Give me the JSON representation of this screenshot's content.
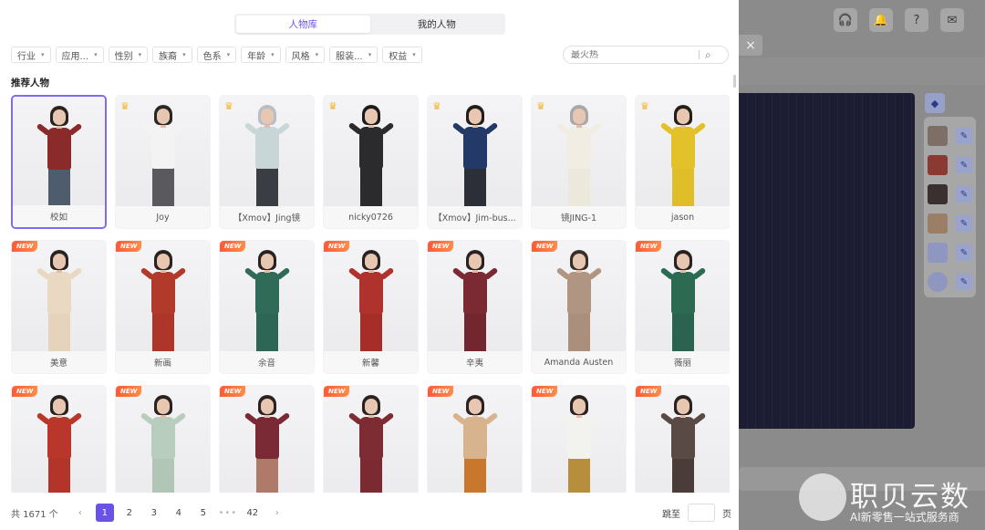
{
  "tabs": [
    {
      "label": "人物库",
      "active": true
    },
    {
      "label": "我的人物",
      "active": false
    }
  ],
  "filters": [
    "行业",
    "应用...",
    "性别",
    "族裔",
    "色系",
    "年龄",
    "风格",
    "服装...",
    "权益"
  ],
  "search": {
    "placeholder": "最火热"
  },
  "section_title": "推荐人物",
  "characters": [
    {
      "name": "校如",
      "badge": "",
      "selected": true,
      "top": "#8b2a2a",
      "bottom": "#4e5c6e",
      "hair": "#2b2320"
    },
    {
      "name": "Joy",
      "badge": "crown",
      "selected": false,
      "top": "#f3f3f3",
      "bottom": "#5a5a5e",
      "hair": "#2a2624"
    },
    {
      "name": "【Xmov】Jing镜",
      "badge": "crown",
      "selected": false,
      "top": "#c8d6d8",
      "bottom": "#3a3e44",
      "hair": "#b9bec4"
    },
    {
      "name": "nicky0726",
      "badge": "crown",
      "selected": false,
      "top": "#2b2b2d",
      "bottom": "#2b2b2d",
      "hair": "#1e1a19"
    },
    {
      "name": "【Xmov】Jim-bus...",
      "badge": "crown",
      "selected": false,
      "top": "#233a69",
      "bottom": "#2c2f38",
      "hair": "#221d1b"
    },
    {
      "name": "镜JING-1",
      "badge": "crown",
      "selected": false,
      "top": "#f1ede2",
      "bottom": "#ede8dc",
      "hair": "#a8a8a8"
    },
    {
      "name": "jason",
      "badge": "crown",
      "selected": false,
      "top": "#e2c12b",
      "bottom": "#dfbe2a",
      "hair": "#241e1b"
    },
    {
      "name": "美意",
      "badge": "NEW",
      "selected": false,
      "top": "#e9d8c2",
      "bottom": "#e6d3bb",
      "hair": "#2a2220"
    },
    {
      "name": "新画",
      "badge": "NEW",
      "selected": false,
      "top": "#b13a2b",
      "bottom": "#ad3628",
      "hair": "#2a2220"
    },
    {
      "name": "余音",
      "badge": "NEW",
      "selected": false,
      "top": "#2f6b57",
      "bottom": "#2d6654",
      "hair": "#2a2220"
    },
    {
      "name": "新馨",
      "badge": "NEW",
      "selected": false,
      "top": "#b0322c",
      "bottom": "#a62d28",
      "hair": "#2a2220"
    },
    {
      "name": "辛夷",
      "badge": "NEW",
      "selected": false,
      "top": "#7b2a33",
      "bottom": "#74262f",
      "hair": "#2a2220"
    },
    {
      "name": "Amanda Austen",
      "badge": "NEW",
      "selected": false,
      "top": "#b09582",
      "bottom": "#a98f7c",
      "hair": "#3a2e29"
    },
    {
      "name": "薇丽",
      "badge": "NEW",
      "selected": false,
      "top": "#2d6a52",
      "bottom": "#2a6450",
      "hair": "#2a2220"
    },
    {
      "name": "",
      "badge": "NEW",
      "selected": false,
      "top": "#b8362a",
      "bottom": "#b33428",
      "hair": "#2a2220"
    },
    {
      "name": "",
      "badge": "NEW",
      "selected": false,
      "top": "#b9cdbf",
      "bottom": "#b2c6b8",
      "hair": "#2a2220"
    },
    {
      "name": "",
      "badge": "NEW",
      "selected": false,
      "top": "#7a2a35",
      "bottom": "#b07a6a",
      "hair": "#2a2220"
    },
    {
      "name": "",
      "badge": "NEW",
      "selected": false,
      "top": "#7e2c33",
      "bottom": "#7a2a30",
      "hair": "#2a2220"
    },
    {
      "name": "",
      "badge": "NEW",
      "selected": false,
      "top": "#d8b48e",
      "bottom": "#c8772c",
      "hair": "#2a2220"
    },
    {
      "name": "",
      "badge": "NEW",
      "selected": false,
      "top": "#f2f2ef",
      "bottom": "#b78e3c",
      "hair": "#2a2220"
    },
    {
      "name": "",
      "badge": "NEW",
      "selected": false,
      "top": "#5a4a45",
      "bottom": "#4a3c38",
      "hair": "#2a2220"
    }
  ],
  "pagination": {
    "total": "共 1671 个",
    "pages": [
      "1",
      "2",
      "3",
      "4",
      "5"
    ],
    "ellipsis": "•••",
    "last": "42",
    "prev": "‹",
    "next": "›",
    "jump_label": "跳至",
    "jump_suffix": "页"
  },
  "bg_app": {
    "close": "×",
    "watermark_title": "职贝云数",
    "watermark_sub": "AI新零售一站式服务商"
  },
  "colors": {
    "accent": "#6b52e6",
    "canvas": "#1c1d33"
  }
}
